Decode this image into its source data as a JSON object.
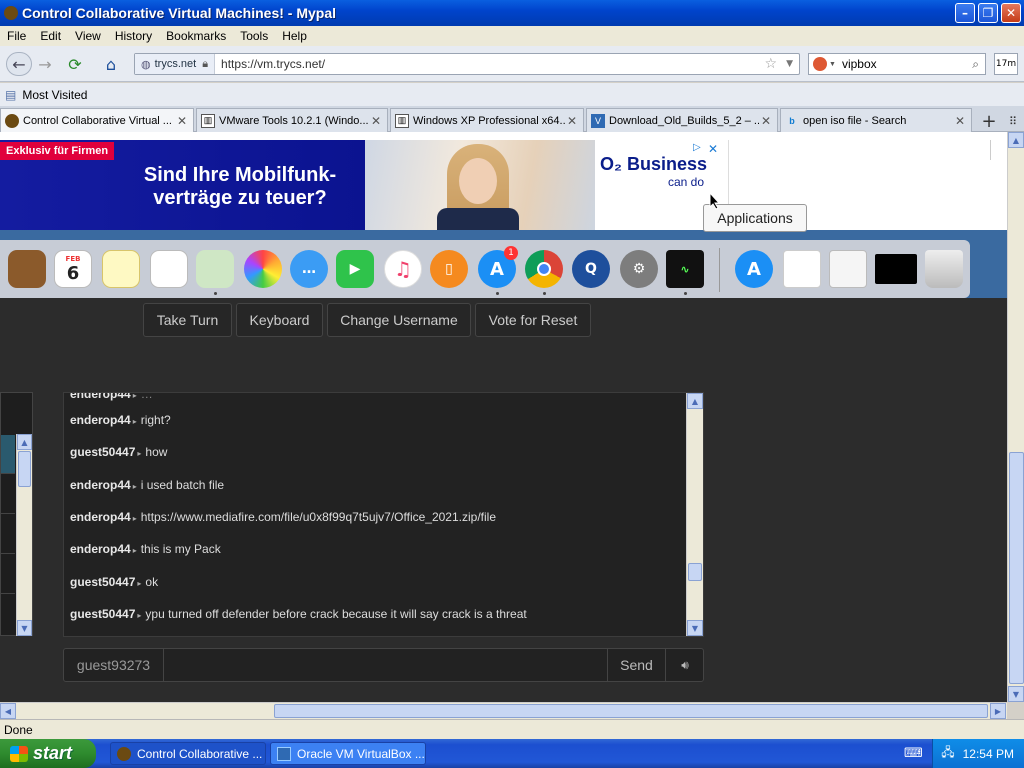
{
  "window": {
    "title": "Control Collaborative Virtual Machines! - Mypal"
  },
  "menu": [
    "File",
    "Edit",
    "View",
    "History",
    "Bookmarks",
    "Tools",
    "Help"
  ],
  "nav": {
    "site_identity": "trycs.net",
    "url": "https://vm.trycs.net/",
    "search_engine": "DuckDuckGo",
    "search_value": "vipbox",
    "addon_badge": "17m"
  },
  "bookmarks": {
    "most_visited": "Most Visited"
  },
  "tabs": [
    {
      "label": "Control Collaborative Virtual ...",
      "icon": "mypal-icon",
      "active": true
    },
    {
      "label": "VMware Tools 10.2.1 (Windo...",
      "icon": "archive-icon",
      "active": false
    },
    {
      "label": "Windows XP Professional x64...",
      "icon": "archive-icon",
      "active": false
    },
    {
      "label": "Download_Old_Builds_5_2 – ...",
      "icon": "virtualbox-icon",
      "active": false
    },
    {
      "label": "open iso file - Search",
      "icon": "bing-icon",
      "active": false
    }
  ],
  "ad": {
    "badge": "Exklusiv für Firmen",
    "headline": "Sind Ihre Mobilfunk-verträge zu teuer?",
    "brand": "O₂ Business",
    "tagline": "can do",
    "close": "✕"
  },
  "vm": {
    "tooltip": "Applications",
    "dock_badge": "1",
    "calendar_month": "FEB",
    "calendar_day": "6"
  },
  "controls": [
    "Take Turn",
    "Keyboard",
    "Change Username",
    "Vote for Reset"
  ],
  "chat": {
    "messages": [
      {
        "user": "enderop44",
        "text": "right?"
      },
      {
        "user": "guest50447",
        "text": "how"
      },
      {
        "user": "enderop44",
        "text": "i used batch file"
      },
      {
        "user": "enderop44",
        "text": "https://www.mediafire.com/file/u0x8f99q7t5ujv7/Office_2021.zip/file"
      },
      {
        "user": "enderop44",
        "text": "this is my Pack"
      },
      {
        "user": "guest50447",
        "text": "ok"
      },
      {
        "user": "guest50447",
        "text": "ypu turned off defender before crack because it will say crack is a threat"
      }
    ],
    "username": "guest93273",
    "input_value": "",
    "send_label": "Send"
  },
  "status": {
    "text": "Done"
  },
  "taskbar": {
    "start_label": "start",
    "tasks": [
      {
        "label": "Control Collaborative ...",
        "active": true
      },
      {
        "label": "Oracle VM VirtualBox ...",
        "active": false
      }
    ],
    "clock": "12:54 PM"
  }
}
